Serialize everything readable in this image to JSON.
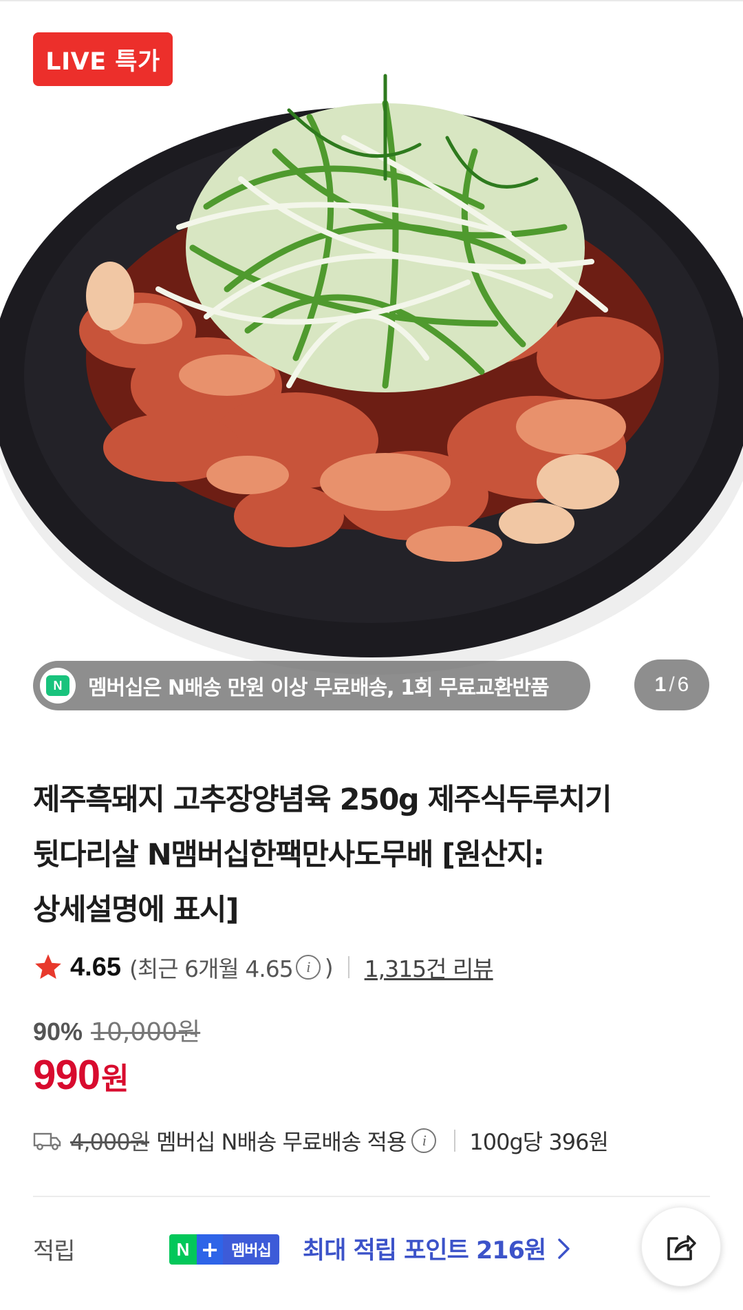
{
  "hero": {
    "live_badge": "LIVE 특가",
    "membership_banner": "멤버십은 N배송 만원 이상 무료배송, 1회 무료교환반품",
    "banner_icon_letter": "N",
    "page_current": "1",
    "page_separator": "/",
    "page_total": "6"
  },
  "product": {
    "title_line1": "제주흑돼지 고추장양념육 250g 제주식두루치기",
    "title_line2": "뒷다리살 N맴버십한팩만사도무배 [원산지:",
    "title_line3": "상세설명에 표시]"
  },
  "rating": {
    "score": "4.65",
    "recent_open": "(최근 6개월 4.65",
    "recent_close": ")",
    "info_glyph": "i",
    "review_count": "1,315건 리뷰"
  },
  "price": {
    "discount_rate": "90%",
    "original": "10,000원",
    "current_value": "990",
    "current_unit": "원"
  },
  "shipping": {
    "original_fee": "4,000원",
    "text": "멤버십 N배송 무료배송 적용",
    "info_glyph": "i",
    "unit_price": "100g당 396원"
  },
  "points": {
    "label": "적립",
    "badge_n": "N",
    "badge_plus": "+",
    "badge_text": "멤버십",
    "text": "최대 적립 포인트 216원"
  },
  "colors": {
    "accent_red": "#ec2f2b",
    "price_red": "#d80b2e",
    "points_blue": "#3c53c9",
    "naver_green": "#03c75a"
  },
  "icons": [
    "n-delivery-icon",
    "star-icon",
    "info-icon",
    "truck-icon",
    "chevron-right-icon",
    "share-icon"
  ]
}
